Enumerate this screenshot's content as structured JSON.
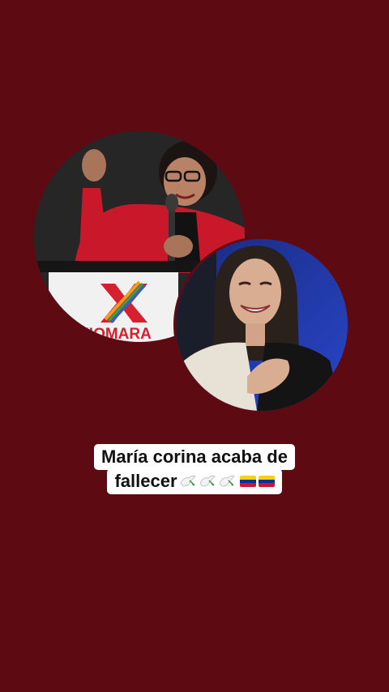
{
  "post": {
    "caption": {
      "line1": "María corina acaba de",
      "line2": "fallecer"
    },
    "photos": [
      {
        "subject": "woman-at-podium",
        "podium_text": "XIOMARA"
      },
      {
        "subject": "smiling-woman-hand-on-chest"
      }
    ],
    "emojis": [
      "dove-icon",
      "dove-icon",
      "dove-icon",
      "venezuela-flag-icon",
      "venezuela-flag-icon"
    ]
  },
  "colors": {
    "background": "#5e0a13",
    "caption_bg": "#ffffff",
    "caption_text": "#111111",
    "flag_yellow": "#f7d117",
    "flag_blue": "#0033a0",
    "flag_red": "#cf142b"
  }
}
